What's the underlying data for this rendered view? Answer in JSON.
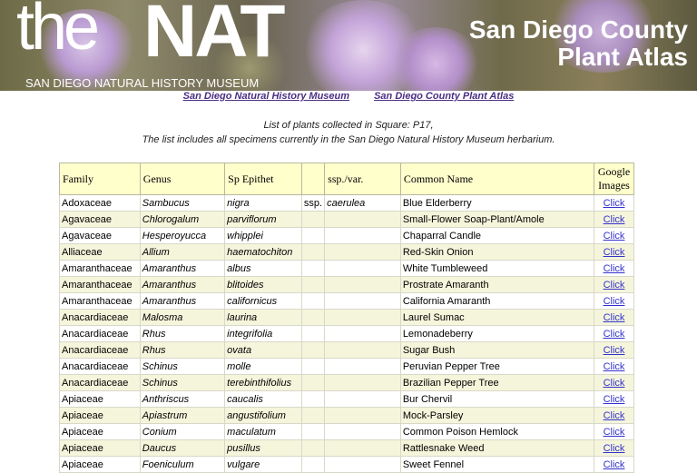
{
  "banner": {
    "logo_the": "the",
    "logo_nat": "NAT",
    "logo_sub": "SAN DIEGO NATURAL HISTORY MUSEUM",
    "title_line1": "San Diego County",
    "title_line2": "Plant Atlas"
  },
  "nav": {
    "link1": "San Diego Natural History Museum",
    "link2": "San Diego County Plant Atlas"
  },
  "intro": {
    "line1": "List of plants collected in Square: P17,",
    "line2": "The list includes all specimens currently in the San Diego Natural History Museum herbarium."
  },
  "table": {
    "headers": {
      "family": "Family",
      "genus": "Genus",
      "epithet": "Sp Epithet",
      "ssp_var": "ssp./var.",
      "common": "Common Name",
      "images_line1": "Google",
      "images_line2": "Images"
    },
    "rows": [
      {
        "family": "Adoxaceae",
        "genus": "Sambucus",
        "epithet": "nigra",
        "rank": "ssp.",
        "infra": "caerulea",
        "common": "Blue Elderberry",
        "link": "Click"
      },
      {
        "family": "Agavaceae",
        "genus": "Chlorogalum",
        "epithet": "parviflorum",
        "rank": "",
        "infra": "",
        "common": "Small-Flower Soap-Plant/Amole",
        "link": "Click"
      },
      {
        "family": "Agavaceae",
        "genus": "Hesperoyucca",
        "epithet": "whipplei",
        "rank": "",
        "infra": "",
        "common": "Chaparral Candle",
        "link": "Click"
      },
      {
        "family": "Alliaceae",
        "genus": "Allium",
        "epithet": "haematochiton",
        "rank": "",
        "infra": "",
        "common": "Red-Skin Onion",
        "link": "Click"
      },
      {
        "family": "Amaranthaceae",
        "genus": "Amaranthus",
        "epithet": "albus",
        "rank": "",
        "infra": "",
        "common": "White Tumbleweed",
        "link": "Click"
      },
      {
        "family": "Amaranthaceae",
        "genus": "Amaranthus",
        "epithet": "blitoides",
        "rank": "",
        "infra": "",
        "common": "Prostrate Amaranth",
        "link": "Click"
      },
      {
        "family": "Amaranthaceae",
        "genus": "Amaranthus",
        "epithet": "californicus",
        "rank": "",
        "infra": "",
        "common": "California Amaranth",
        "link": "Click"
      },
      {
        "family": "Anacardiaceae",
        "genus": "Malosma",
        "epithet": "laurina",
        "rank": "",
        "infra": "",
        "common": "Laurel Sumac",
        "link": "Click"
      },
      {
        "family": "Anacardiaceae",
        "genus": "Rhus",
        "epithet": "integrifolia",
        "rank": "",
        "infra": "",
        "common": "Lemonadeberry",
        "link": "Click"
      },
      {
        "family": "Anacardiaceae",
        "genus": "Rhus",
        "epithet": "ovata",
        "rank": "",
        "infra": "",
        "common": "Sugar Bush",
        "link": "Click"
      },
      {
        "family": "Anacardiaceae",
        "genus": "Schinus",
        "epithet": "molle",
        "rank": "",
        "infra": "",
        "common": "Peruvian Pepper Tree",
        "link": "Click"
      },
      {
        "family": "Anacardiaceae",
        "genus": "Schinus",
        "epithet": "terebinthifolius",
        "rank": "",
        "infra": "",
        "common": "Brazilian Pepper Tree",
        "link": "Click"
      },
      {
        "family": "Apiaceae",
        "genus": "Anthriscus",
        "epithet": "caucalis",
        "rank": "",
        "infra": "",
        "common": "Bur Chervil",
        "link": "Click"
      },
      {
        "family": "Apiaceae",
        "genus": "Apiastrum",
        "epithet": "angustifolium",
        "rank": "",
        "infra": "",
        "common": "Mock-Parsley",
        "link": "Click"
      },
      {
        "family": "Apiaceae",
        "genus": "Conium",
        "epithet": "maculatum",
        "rank": "",
        "infra": "",
        "common": "Common Poison Hemlock",
        "link": "Click"
      },
      {
        "family": "Apiaceae",
        "genus": "Daucus",
        "epithet": "pusillus",
        "rank": "",
        "infra": "",
        "common": "Rattlesnake Weed",
        "link": "Click"
      },
      {
        "family": "Apiaceae",
        "genus": "Foeniculum",
        "epithet": "vulgare",
        "rank": "",
        "infra": "",
        "common": "Sweet Fennel",
        "link": "Click"
      }
    ]
  },
  "colors": {
    "header_bg": "#ffffcc",
    "row_alt_bg": "#f5f5dc",
    "nav_link": "#4b2e83",
    "click_link": "#3333cc"
  }
}
